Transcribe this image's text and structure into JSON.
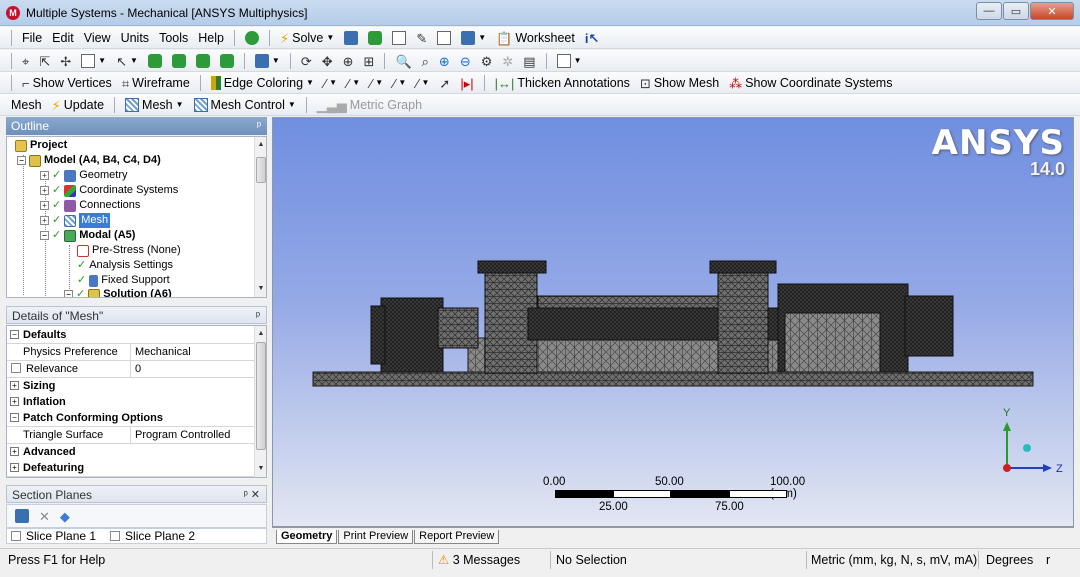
{
  "window": {
    "title": "Multiple Systems - Mechanical [ANSYS Multiphysics]",
    "app_icon_letter": "M",
    "minimize": "—",
    "maximize": "▭",
    "close": "✕"
  },
  "toolbar1": {
    "menus": [
      "File",
      "Edit",
      "View",
      "Units",
      "Tools",
      "Help"
    ],
    "solve": "Solve",
    "worksheet": "Worksheet"
  },
  "toolbar3": {
    "show_vertices": "Show Vertices",
    "wireframe": "Wireframe",
    "edge_coloring": "Edge Coloring",
    "thicken_annotations": "Thicken Annotations",
    "show_mesh": "Show Mesh",
    "show_coordinate_systems": "Show Coordinate Systems"
  },
  "toolbar4": {
    "context": "Mesh",
    "update": "Update",
    "mesh": "Mesh",
    "mesh_control": "Mesh Control",
    "metric_graph": "Metric Graph"
  },
  "outline": {
    "title": "Outline",
    "pin": "ᵖ",
    "items": [
      {
        "label": "Project"
      },
      {
        "label": "Model (A4, B4, C4, D4)"
      },
      {
        "label": "Geometry"
      },
      {
        "label": "Coordinate Systems"
      },
      {
        "label": "Connections"
      },
      {
        "label": "Mesh"
      },
      {
        "label": "Modal (A5)"
      },
      {
        "label": "Pre-Stress (None)"
      },
      {
        "label": "Analysis Settings"
      },
      {
        "label": "Fixed Support"
      },
      {
        "label": "Solution (A6)"
      }
    ]
  },
  "details": {
    "title": "Details of \"Mesh\"",
    "pin": "ᵖ",
    "rows": [
      {
        "group": "Defaults"
      },
      {
        "key": "Physics Preference",
        "value": "Mechanical"
      },
      {
        "key": "Relevance",
        "value": "0"
      },
      {
        "group": "Sizing"
      },
      {
        "group": "Inflation"
      },
      {
        "group": "Patch Conforming Options"
      },
      {
        "key": "Triangle Surface Mesher",
        "value": "Program Controlled"
      },
      {
        "group": "Advanced"
      },
      {
        "group": "Defeaturing"
      }
    ]
  },
  "section_planes": {
    "title": "Section Planes",
    "pin": "ᵖ ✕",
    "planes": [
      "Slice Plane 1",
      "Slice Plane 2"
    ]
  },
  "viewport": {
    "brand": "ANSYS",
    "version": "14.0",
    "scale": {
      "top_labels": [
        "0.00",
        "50.00",
        "100.00 (mm)"
      ],
      "bottom_labels": [
        "25.00",
        "75.00"
      ]
    },
    "axes": {
      "y": "Y",
      "z": "Z"
    },
    "tabs": [
      "Geometry",
      "Print Preview",
      "Report Preview"
    ]
  },
  "status": {
    "help": "Press F1 for Help",
    "messages": "3 Messages",
    "selection": "No Selection",
    "units": "Metric (mm, kg, N, s, mV, mA)",
    "angle": "Degrees",
    "extra": "r"
  },
  "colors": {
    "viewport_top": "#6f8fe0",
    "viewport_bottom": "#e3e7f2",
    "selection": "#3a7dd8",
    "panel_header": "#6f90bb"
  }
}
